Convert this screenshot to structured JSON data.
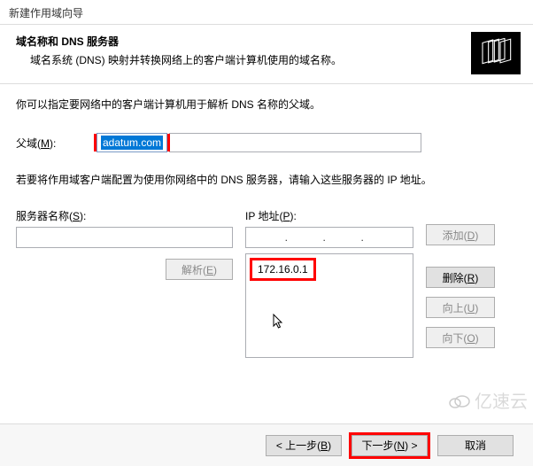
{
  "titlebar": "新建作用域向导",
  "header": {
    "title": "域名称和 DNS 服务器",
    "subtitle": "域名系统 (DNS) 映射并转换网络上的客户端计算机使用的域名称。"
  },
  "intro": "你可以指定要网络中的客户端计算机用于解析 DNS 名称的父域。",
  "parent_domain": {
    "label_pre": "父域(",
    "label_u": "M",
    "label_post": "):",
    "value": "adatum.com"
  },
  "dns_note": "若要将作用域客户端配置为使用你网络中的 DNS 服务器，请输入这些服务器的 IP 地址。",
  "server_name": {
    "label_pre": "服务器名称(",
    "label_u": "S",
    "label_post": "):",
    "value": ""
  },
  "resolve": {
    "label_pre": "解析(",
    "label_u": "E",
    "label_post": ")"
  },
  "ip": {
    "label_pre": "IP 地址(",
    "label_u": "P",
    "label_post": "):",
    "seg1": "",
    "seg2": "",
    "seg3": "",
    "seg4": "",
    "list_item": "172.16.0.1"
  },
  "side": {
    "add_pre": "添加(",
    "add_u": "D",
    "add_post": ")",
    "del_pre": "删除(",
    "del_u": "R",
    "del_post": ")",
    "up_pre": "向上(",
    "up_u": "U",
    "up_post": ")",
    "down_pre": "向下(",
    "down_u": "O",
    "down_post": ")"
  },
  "footer": {
    "back_pre": "< 上一步(",
    "back_u": "B",
    "back_post": ")",
    "next_pre": "下一步(",
    "next_u": "N",
    "next_post": ") >",
    "cancel": "取消"
  },
  "watermark": "亿速云"
}
